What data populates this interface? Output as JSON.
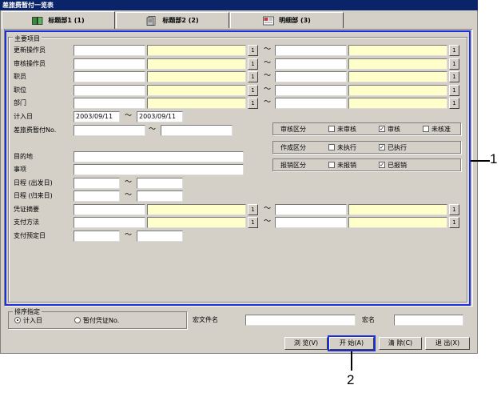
{
  "window": {
    "title": "差旅费暂付一览表"
  },
  "tabs": [
    {
      "label": "标题部1 (1)",
      "icon": "book-icon"
    },
    {
      "label": "标题部2 (2)",
      "icon": "document-icon"
    },
    {
      "label": "明细部 (3)",
      "icon": "detail-icon"
    }
  ],
  "main_group": {
    "title": "主要项目"
  },
  "range_rows": [
    {
      "label": "更新操作员",
      "btn": "1"
    },
    {
      "label": "审核操作员",
      "btn": "1"
    },
    {
      "label": "职员",
      "btn": "1"
    },
    {
      "label": "职位",
      "btn": "1"
    },
    {
      "label": "部门",
      "btn": "1"
    }
  ],
  "tilde": "～",
  "entry_date": {
    "label": "计入日",
    "from": "2003/09/11",
    "to": "2003/09/11"
  },
  "advance_no": {
    "label": "差旅费暂付No.",
    "from": "",
    "to": ""
  },
  "review_status": {
    "label": "审核区分",
    "options": [
      {
        "label": "未审核",
        "checked": false
      },
      {
        "label": "审核",
        "checked": true
      },
      {
        "label": "未核准",
        "checked": false
      }
    ]
  },
  "create_status": {
    "label": "作成区分",
    "options": [
      {
        "label": "未执行",
        "checked": false
      },
      {
        "label": "已执行",
        "checked": true
      }
    ]
  },
  "reimburse_status": {
    "label": "报销区分",
    "options": [
      {
        "label": "未报销",
        "checked": false
      },
      {
        "label": "已报销",
        "checked": true
      }
    ]
  },
  "destination": {
    "label": "目的地"
  },
  "purpose": {
    "label": "事项"
  },
  "depart_date": {
    "label": "日程 (出发日)"
  },
  "return_date": {
    "label": "日程 (归来日)"
  },
  "voucher_summary": {
    "label": "凭证摘要",
    "btn": "1"
  },
  "payment_method": {
    "label": "支付方法",
    "btn": "1"
  },
  "payment_date": {
    "label": "支付预定日"
  },
  "sort": {
    "title": "排序指定",
    "options": [
      {
        "label": "计入日",
        "selected": true
      },
      {
        "label": "暂付凭证No.",
        "selected": false
      }
    ]
  },
  "macro_file": {
    "label": "宏文件名",
    "value": ""
  },
  "macro_name": {
    "label": "宏名",
    "value": ""
  },
  "buttons": {
    "browse": "浏  览(V)",
    "start": "开  始(A)",
    "clear": "清  除(C)",
    "exit": "退  出(X)"
  },
  "callouts": {
    "one": "1",
    "two": "2"
  },
  "colors": {
    "title_bar": "#0a246a",
    "highlight": "#1a2fd8",
    "yellow_field": "#ffffcc"
  }
}
